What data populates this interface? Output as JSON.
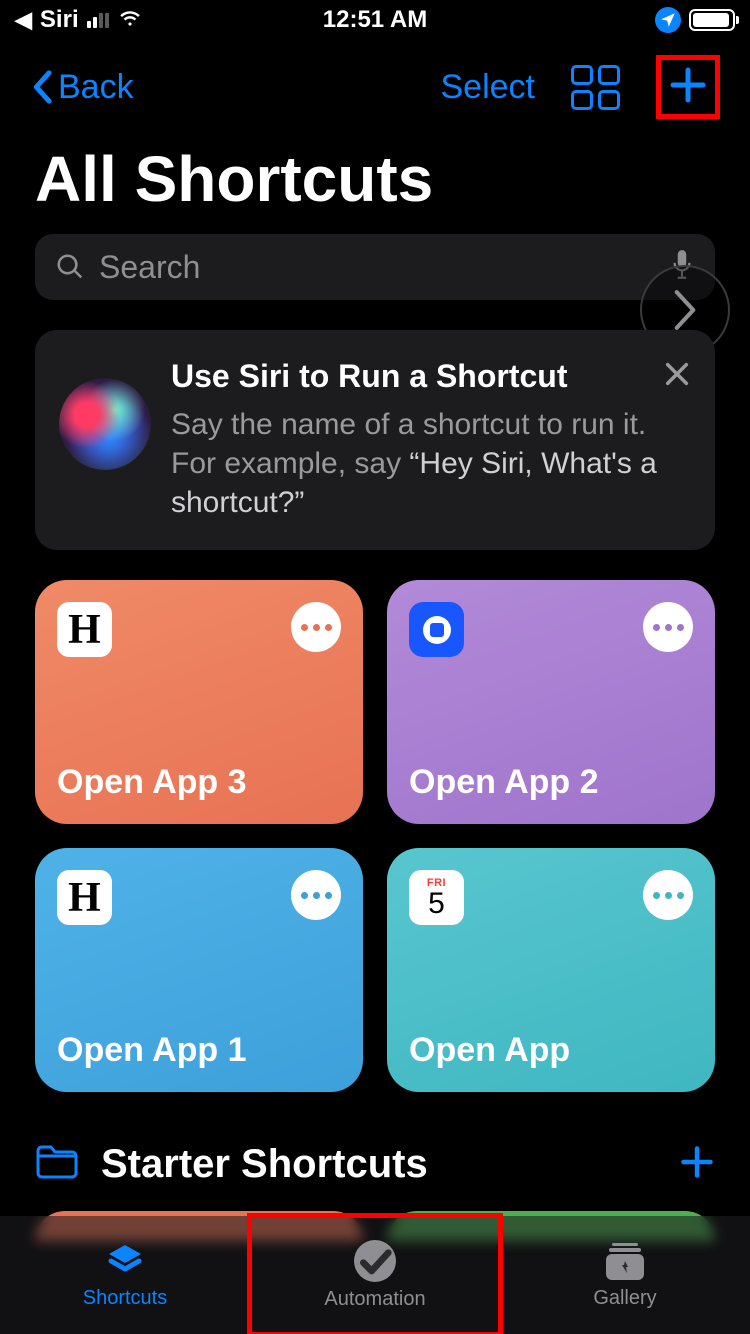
{
  "status_bar": {
    "back_app": "Siri",
    "time": "12:51 AM"
  },
  "nav": {
    "back_label": "Back",
    "select_label": "Select"
  },
  "page_title": "All Shortcuts",
  "search": {
    "placeholder": "Search"
  },
  "siri_tip": {
    "title": "Use Siri to Run a Shortcut",
    "body_lead": "Say the name of a shortcut to run it. For example, say ",
    "body_quote": "“Hey Siri, What's a shortcut?”"
  },
  "shortcuts": [
    {
      "label": "Open App 3"
    },
    {
      "label": "Open App 2"
    },
    {
      "label": "Open App 1"
    },
    {
      "label": "Open App"
    }
  ],
  "calendar_icon": {
    "dow": "FRI",
    "dom": "5"
  },
  "starter_section": {
    "title": "Starter Shortcuts"
  },
  "tabs": {
    "shortcuts": "Shortcuts",
    "automation": "Automation",
    "gallery": "Gallery"
  }
}
